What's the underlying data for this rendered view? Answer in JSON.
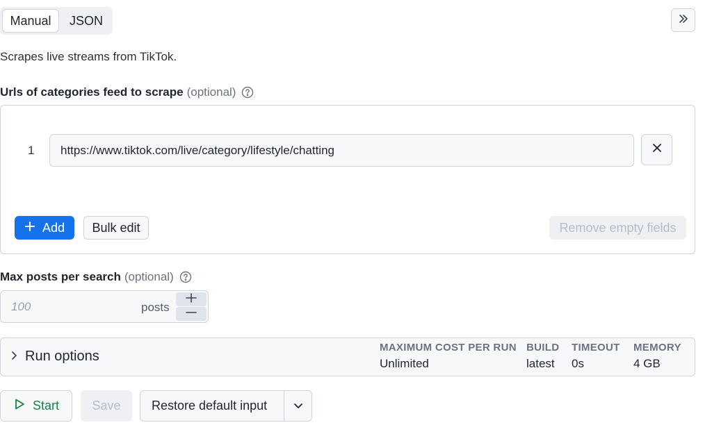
{
  "mode_tabs": [
    "Manual",
    "JSON"
  ],
  "description": "Scrapes live streams from TikTok.",
  "urls_field": {
    "label": "Urls of categories feed to scrape",
    "optional": "(optional)",
    "rows": [
      {
        "index": "1",
        "value": "https://www.tiktok.com/live/category/lifestyle/chatting"
      }
    ],
    "add_label": "Add",
    "bulk_edit_label": "Bulk edit",
    "remove_empty_label": "Remove empty fields"
  },
  "max_posts_field": {
    "label": "Max posts per search",
    "optional": "(optional)",
    "placeholder": "100",
    "suffix": "posts"
  },
  "run_options": {
    "title": "Run options",
    "meta": [
      {
        "label": "MAXIMUM COST PER RUN",
        "value": "Unlimited"
      },
      {
        "label": "BUILD",
        "value": "latest"
      },
      {
        "label": "TIMEOUT",
        "value": "0s"
      },
      {
        "label": "MEMORY",
        "value": "4 GB"
      }
    ]
  },
  "actions": {
    "start_label": "Start",
    "save_label": "Save",
    "restore_label": "Restore default input"
  },
  "colors": {
    "primary": "#1672eb",
    "start_green": "#168245",
    "border": "#cfd4dc",
    "disabled_text": "#b6bcc8"
  },
  "icons": [
    "collapse-double-chevron-right-icon",
    "help-circle-icon",
    "close-icon",
    "plus-icon",
    "minus-icon",
    "chevron-right-icon",
    "play-icon",
    "chevron-down-icon"
  ]
}
